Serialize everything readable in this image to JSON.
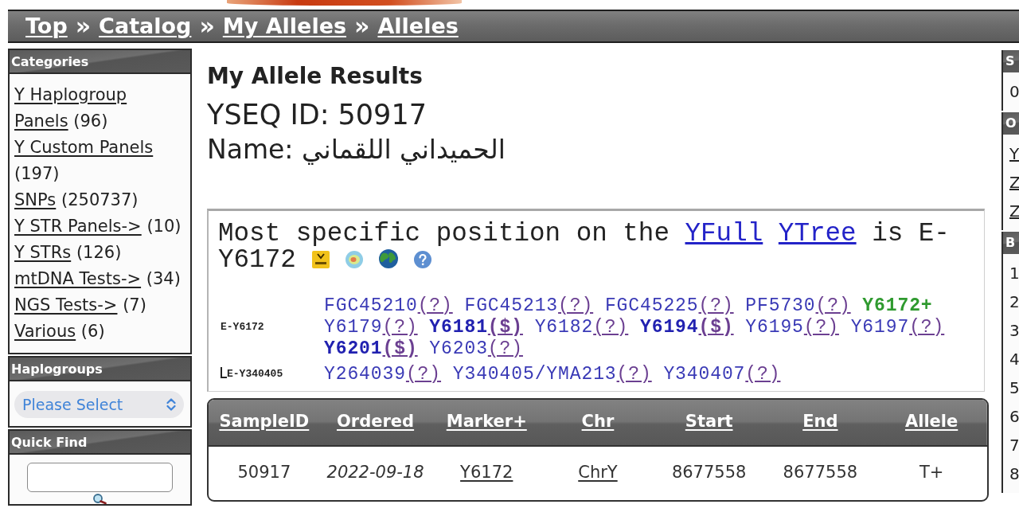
{
  "breadcrumb": [
    {
      "label": "Top"
    },
    {
      "separator": "»",
      "label": "Catalog"
    },
    {
      "separator": "»",
      "label": "My Alleles"
    },
    {
      "separator": "»",
      "label": "Alleles"
    }
  ],
  "sidebar": {
    "categories": {
      "title": "Categories",
      "items": [
        {
          "label": "Y Haplogroup Panels",
          "count": "(96)"
        },
        {
          "label": "Y Custom Panels",
          "count": "(197)"
        },
        {
          "label": "SNPs",
          "count": "(250737)"
        },
        {
          "label": "Y STR Panels->",
          "count": "(10)"
        },
        {
          "label": "Y STRs",
          "count": "(126)"
        },
        {
          "label": "mtDNA Tests->",
          "count": "(34)"
        },
        {
          "label": "NGS Tests->",
          "count": "(7)"
        },
        {
          "label": "Various",
          "count": "(6)"
        }
      ]
    },
    "haplogroups": {
      "title": "Haplogroups",
      "select": {
        "value": "Please Select"
      }
    },
    "quick_find": {
      "title": "Quick Find"
    }
  },
  "main": {
    "title": "My Allele Results",
    "yseq_id": "YSEQ ID: 50917",
    "name": "Name: الحميداني اللقماني",
    "tree": {
      "sentence": [
        {
          "text": "Most specific position on the",
          "kind": "text"
        },
        {
          "text": "YFull",
          "kind": "link"
        },
        {
          "text": "YTree",
          "kind": "link"
        },
        {
          "text": "is E-Y6172",
          "kind": "text"
        }
      ],
      "clades": [
        {
          "label": "E-Y6172",
          "snps": [
            {
              "name": "FGC45210",
              "kind": "unknown",
              "link": "(?)"
            },
            {
              "name": "FGC45213",
              "kind": "unknown",
              "link": "(?)"
            },
            {
              "name": "FGC45225",
              "kind": "unknown",
              "link": "(?)"
            },
            {
              "name": "PF5730",
              "kind": "unknown",
              "link": "(?)"
            },
            {
              "name": "Y6172+",
              "kind": "positive"
            },
            {
              "name": "Y6179",
              "kind": "unknown",
              "link": "(?)"
            },
            {
              "name": "Y6181",
              "kind": "available",
              "link": "($)"
            },
            {
              "name": "Y6182",
              "kind": "unknown",
              "link": "(?)"
            },
            {
              "name": "Y6194",
              "kind": "available",
              "link": "($)"
            },
            {
              "name": "Y6195",
              "kind": "unknown",
              "link": "(?)"
            },
            {
              "name": "Y6197",
              "kind": "unknown",
              "link": "(?)"
            },
            {
              "name": "Y6201",
              "kind": "available",
              "link": "($)"
            },
            {
              "name": "Y6203",
              "kind": "unknown",
              "link": "(?)"
            }
          ],
          "children": [
            {
              "label": "E-Y340405",
              "snps": [
                {
                  "name": "Y264039",
                  "kind": "unknown",
                  "link": "(?)"
                },
                {
                  "name": "Y340405/YMA213",
                  "kind": "unknown",
                  "link": "(?)"
                },
                {
                  "name": "Y340407",
                  "kind": "unknown",
                  "link": "(?)"
                }
              ]
            }
          ]
        }
      ]
    },
    "table": {
      "columns": [
        "SampleID",
        "Ordered",
        "Marker+",
        "Chr",
        "Start",
        "End",
        "Allele"
      ],
      "rows": [
        {
          "cells": [
            {
              "text": "50917",
              "kind": "plain"
            },
            {
              "text": "2022-09-18",
              "kind": "date"
            },
            {
              "text": "Y6172",
              "kind": "link"
            },
            {
              "text": "ChrY",
              "kind": "link"
            },
            {
              "text": "8677558",
              "kind": "plain"
            },
            {
              "text": "8677558",
              "kind": "plain"
            },
            {
              "text": "T+",
              "kind": "plain"
            }
          ]
        }
      ]
    }
  },
  "right_sidebar": {
    "panels": [
      {
        "title": "S",
        "items": [
          {
            "text": "0",
            "kind": "text"
          }
        ]
      },
      {
        "title": "O",
        "items": [
          {
            "text": "Y",
            "kind": "link"
          },
          {
            "text": "Z",
            "kind": "link"
          },
          {
            "text": "Z",
            "kind": "link"
          }
        ]
      },
      {
        "title": "B",
        "items": [
          {
            "text": "1",
            "kind": "text"
          },
          {
            "text": "2",
            "kind": "text"
          },
          {
            "text": "3",
            "kind": "text"
          },
          {
            "text": "4",
            "kind": "text"
          },
          {
            "text": "5",
            "kind": "text"
          },
          {
            "text": "6",
            "kind": "text"
          },
          {
            "text": "7",
            "kind": "text"
          },
          {
            "text": "8",
            "kind": "text"
          }
        ]
      }
    ]
  }
}
